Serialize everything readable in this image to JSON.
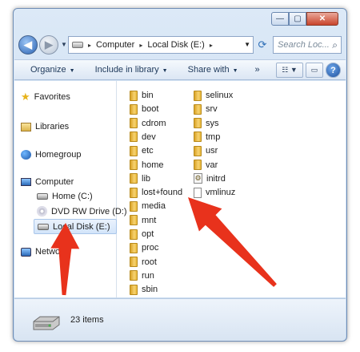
{
  "window": {
    "minimize_glyph": "—",
    "maximize_glyph": "▢",
    "close_glyph": "✕"
  },
  "address_bar": {
    "segments": [
      "Computer",
      "Local Disk (E:)"
    ],
    "separator": "▸"
  },
  "search": {
    "placeholder": "Search Loc..."
  },
  "toolbar": {
    "organize": "Organize",
    "include_in_library": "Include in library",
    "share_with": "Share with",
    "more": "»"
  },
  "navigation": {
    "favorites": "Favorites",
    "libraries": "Libraries",
    "homegroup": "Homegroup",
    "computer": "Computer",
    "drives": [
      "Home (C:)",
      "DVD RW Drive (D:)",
      "Local Disk (E:)"
    ],
    "network": "Network",
    "selected": "Local Disk (E:)"
  },
  "files": {
    "column1": [
      "bin",
      "boot",
      "cdrom",
      "dev",
      "etc",
      "home",
      "lib",
      "lost+found",
      "media",
      "mnt",
      "opt",
      "proc",
      "root",
      "run",
      "sbin"
    ],
    "column2": [
      {
        "name": "selinux",
        "type": "folder"
      },
      {
        "name": "srv",
        "type": "folder"
      },
      {
        "name": "sys",
        "type": "folder"
      },
      {
        "name": "tmp",
        "type": "folder"
      },
      {
        "name": "usr",
        "type": "folder"
      },
      {
        "name": "var",
        "type": "folder"
      },
      {
        "name": "initrd",
        "type": "image-file"
      },
      {
        "name": "vmlinuz",
        "type": "file"
      }
    ]
  },
  "status_bar": {
    "item_count": "23 items"
  },
  "annotation_color": "#e8321c"
}
